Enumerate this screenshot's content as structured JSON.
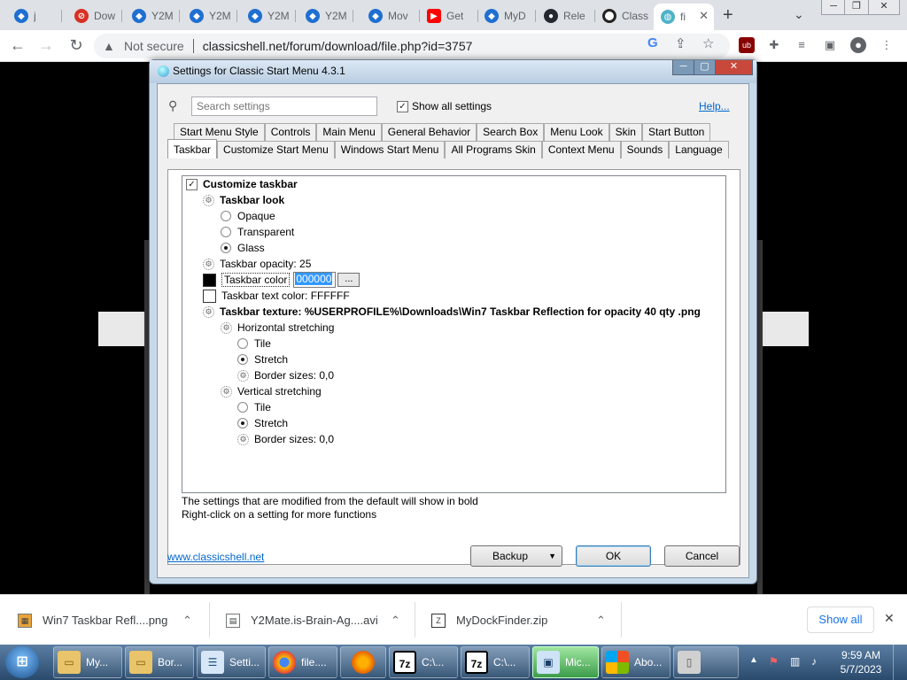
{
  "browser": {
    "tabs": [
      {
        "title": "j",
        "icon": "edge-blue-icon"
      },
      {
        "title": "Dow",
        "icon": "red-circle-icon"
      },
      {
        "title": "Y2M",
        "icon": "edge-blue-icon"
      },
      {
        "title": "Y2M",
        "icon": "edge-blue-icon"
      },
      {
        "title": "Y2M",
        "icon": "edge-blue-icon"
      },
      {
        "title": "Y2M",
        "icon": "edge-blue-icon"
      },
      {
        "title": "Mov",
        "icon": "edge-blue-icon"
      },
      {
        "title": "Get",
        "icon": "youtube-icon"
      },
      {
        "title": "MyD",
        "icon": "edge-blue-icon"
      },
      {
        "title": "Rele",
        "icon": "github-icon"
      },
      {
        "title": "Class",
        "icon": "black-ring-icon"
      },
      {
        "title": "fi",
        "icon": "globe-icon"
      }
    ],
    "not_secure": "Not secure",
    "url": "classicshell.net/forum/download/file.php?id=3757"
  },
  "dialog": {
    "title": "Settings for Classic Start Menu 4.3.1",
    "search_placeholder": "Search settings",
    "show_all": "Show all settings",
    "help": "Help...",
    "tabs_row1": [
      "Start Menu Style",
      "Controls",
      "Main Menu",
      "General Behavior",
      "Search Box",
      "Menu Look",
      "Skin",
      "Start Button"
    ],
    "tabs_row2": [
      "Taskbar",
      "Customize Start Menu",
      "Windows Start Menu",
      "All Programs Skin",
      "Context Menu",
      "Sounds",
      "Language"
    ],
    "tree": {
      "customize_taskbar": "Customize taskbar",
      "taskbar_look": "Taskbar look",
      "opaque": "Opaque",
      "transparent": "Transparent",
      "glass": "Glass",
      "opacity": "Taskbar opacity: 25",
      "color_label": "Taskbar color",
      "color_value": "000000",
      "color_btn": "...",
      "text_color": "Taskbar text color: FFFFFF",
      "texture": "Taskbar texture: %USERPROFILE%\\Downloads\\Win7 Taskbar Reflection for opacity 40 qty .png",
      "h_stretch": "Horizontal stretching",
      "h_tile": "Tile",
      "h_stretch_opt": "Stretch",
      "h_border": "Border sizes: 0,0",
      "v_stretch": "Vertical stretching",
      "v_tile": "Tile",
      "v_stretch_opt": "Stretch",
      "v_border": "Border sizes: 0,0"
    },
    "info1": "The settings that are modified from the default will show in bold",
    "info2": "Right-click on a setting for more functions",
    "site_link": "www.classicshell.net",
    "backup": "Backup",
    "ok": "OK",
    "cancel": "Cancel"
  },
  "downloads": {
    "items": [
      {
        "name": "Win7 Taskbar Refl....png",
        "icon": "image-file-icon"
      },
      {
        "name": "Y2Mate.is-Brain-Ag....avi",
        "icon": "video-file-icon"
      },
      {
        "name": "MyDockFinder.zip",
        "icon": "zip-file-icon"
      }
    ],
    "show_all": "Show all"
  },
  "taskbar": {
    "items": [
      {
        "label": "My...",
        "icon": "folder-icon"
      },
      {
        "label": "Bor...",
        "icon": "folder-icon"
      },
      {
        "label": "Setti...",
        "icon": "settings-icon"
      },
      {
        "label": "file....",
        "icon": "chrome-icon"
      },
      {
        "label": "",
        "icon": "firefox-icon"
      },
      {
        "label": "C:\\...",
        "icon": "7zip-icon"
      },
      {
        "label": "C:\\...",
        "icon": "7zip-icon"
      },
      {
        "label": "Mic...",
        "icon": "computer-icon"
      },
      {
        "label": "Abo...",
        "icon": "windows-icon"
      },
      {
        "label": "",
        "icon": "drive-icon"
      }
    ],
    "time": "9:59 AM",
    "date": "5/7/2023",
    "colors": {
      "active_item": "#3c9c4a"
    }
  }
}
